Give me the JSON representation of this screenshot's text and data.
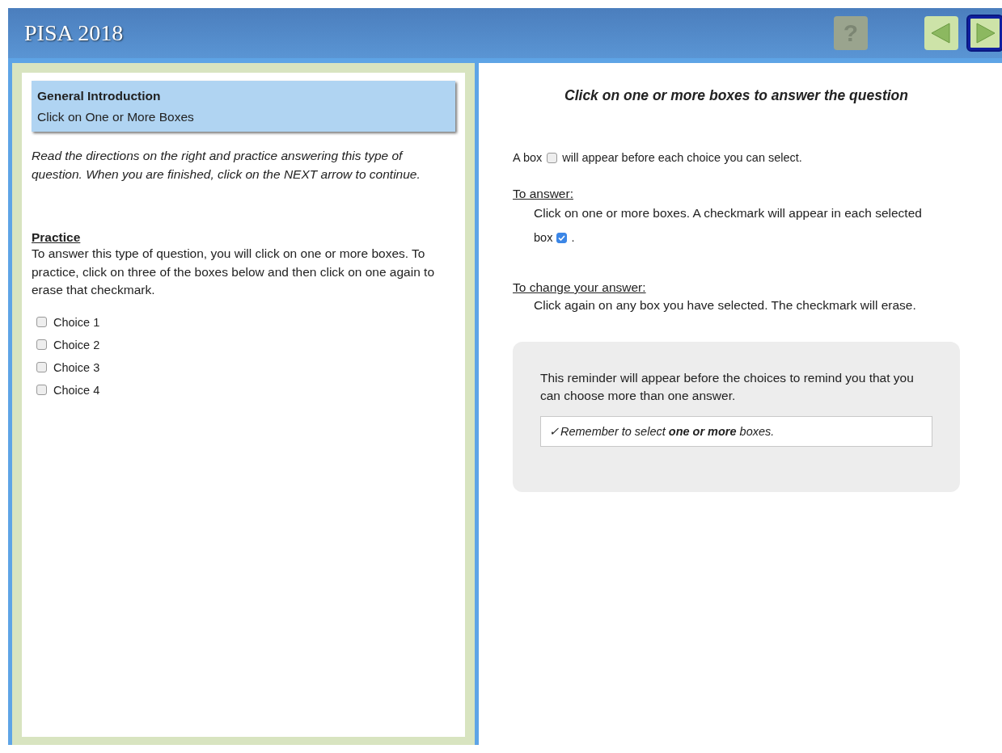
{
  "header": {
    "title": "PISA 2018",
    "help": {
      "label": "?",
      "disabled": true
    },
    "nav": [
      {
        "kind": "prev",
        "focused": false
      },
      {
        "kind": "next",
        "focused": true
      }
    ]
  },
  "left": {
    "card": {
      "title": "General Introduction",
      "subtitle": "Click on One or More Boxes"
    },
    "directions": "Read the directions on the right and practice answering this type of question. When you are finished, click on the NEXT arrow to continue.",
    "practice_heading": "Practice",
    "practice_text": "To answer this type of question, you will click on one or more boxes. To practice, click on three of the boxes below and then click on one again to erase that checkmark.",
    "choices": [
      {
        "label": "Choice 1",
        "checked": false
      },
      {
        "label": "Choice 2",
        "checked": false
      },
      {
        "label": "Choice 3",
        "checked": false
      },
      {
        "label": "Choice 4",
        "checked": false
      }
    ]
  },
  "right": {
    "title": "Click on one or more boxes to answer the question",
    "box_line": {
      "before": "A box",
      "checked": false,
      "after": "will appear before each choice you can select."
    },
    "to_answer": {
      "heading": "To answer:",
      "text": "Click on one or more boxes. A checkmark will appear in each selected",
      "before": "box",
      "checked": true,
      "after": "."
    },
    "to_change": {
      "heading": "To change your answer:",
      "text": "Click again on any box you have selected. The checkmark will erase."
    },
    "reminder": {
      "text": "This reminder will appear before the choices to remind you that you can choose more than one answer.",
      "check": "✓",
      "note": "Remember to select **one or more** boxes."
    }
  }
}
